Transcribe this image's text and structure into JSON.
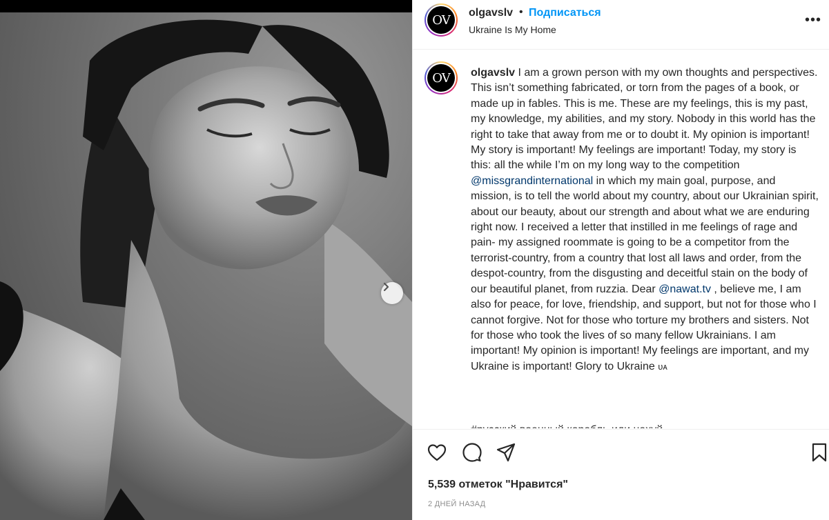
{
  "post": {
    "username": "olgavslv",
    "follow_label": "Подписаться",
    "separator": "•",
    "location": "Ukraine Is My Home",
    "avatar_monogram": "OV",
    "more_label": "•••"
  },
  "caption": {
    "username": "olgavslv",
    "part1": " I am a grown person with my own thoughts and perspectives. This isn’t something fabricated, or torn from the pages of a book, or made up in fables. This is me. These are my feelings, this is my past, my knowledge, my abilities, and my story. Nobody in this world has the right to take that away from me or to doubt it. My opinion is important! My story is important! My feelings are important! Today, my story is this: all the while I’m on my long way to the competition ",
    "mention1": "@missgrandinternational",
    "part2": " in which my main goal, purpose, and mission, is to tell the world about my country, about our Ukrainian spirit, about our beauty, about our strength and about what we are enduring right now. I received a letter that instilled in me feelings of rage and pain- my assigned roommate is going to be a competitor from the terrorist-country, from a country that lost all laws and order, from the despot-country, from the disgusting and deceitful stain on the body of our beautiful planet, from ruzzia. Dear ",
    "mention2": "@nawat.tv",
    "part3": " , believe me, I am also for peace, for love, friendship, and support, but not for those who I cannot forgive. Not for those who torture my brothers and sisters. Not for those who took the lives of so many fellow Ukrainians. I am important! My opinion is important! My feelings are important, and my Ukraine is important! Glory to Ukraine ",
    "flag": "ᴜᴀ",
    "cut_line": "#русский военный корабль иди нахуй"
  },
  "stats": {
    "likes": "5,539 отметок \"Нравится\"",
    "date": "2 ДНЕЙ НАЗАД"
  },
  "icons": {
    "like": "heart-icon",
    "comment": "comment-icon",
    "share": "share-icon",
    "save": "bookmark-icon",
    "next": "chevron-right-icon"
  },
  "colors": {
    "accent": "#0095f6",
    "mention": "#00376b",
    "secondary_text": "#8e8e8e"
  }
}
